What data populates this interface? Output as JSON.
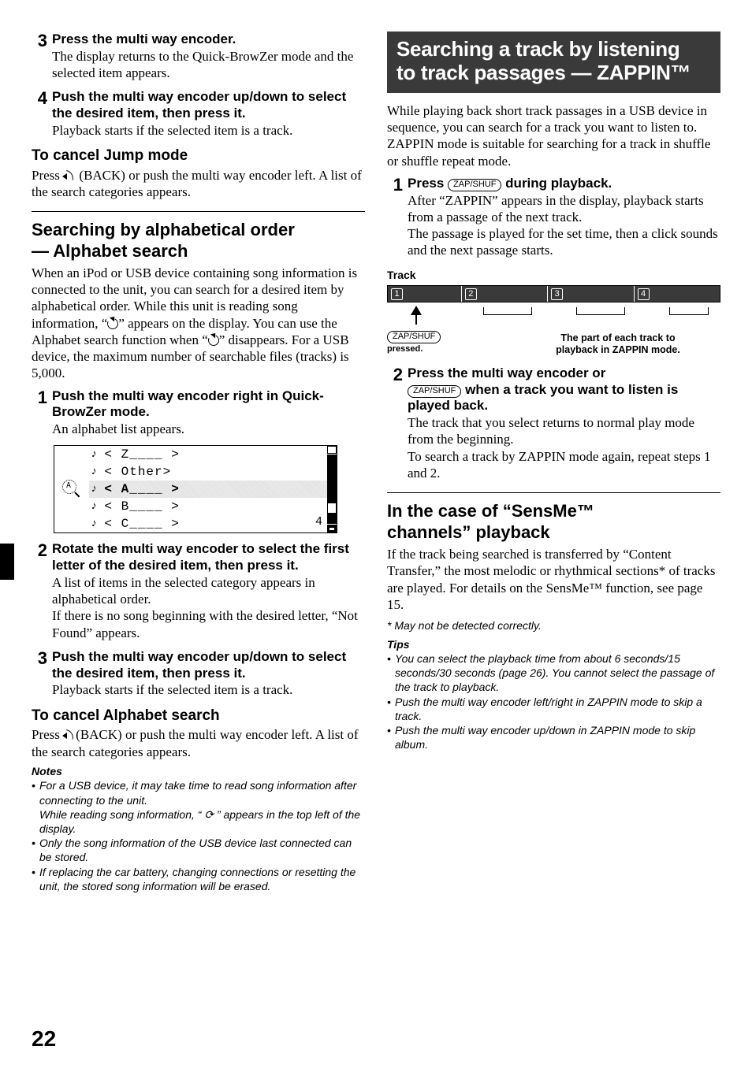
{
  "left": {
    "steps_a": [
      {
        "num": "3",
        "title": "Press the multi way encoder.",
        "text": "The display returns to the Quick-BrowZer mode and the selected item appears."
      },
      {
        "num": "4",
        "title": "Push the multi way encoder up/down to select the desired item, then press it.",
        "text": "Playback starts if the selected item is a track."
      }
    ],
    "cancel_jump": {
      "heading": "To cancel Jump mode",
      "text_before": "Press ",
      "text_after": " (BACK) or push the multi way encoder left. A list of the search categories appears."
    },
    "alpha": {
      "heading_line1": "Searching by alphabetical order",
      "heading_line2": "— Alphabet search",
      "intro_a": "When an iPod or USB device containing song information is connected to the unit, you can search for a desired item by alphabetical order. While this unit is reading song information, “",
      "intro_b": "” appears on the display. You can use the Alphabet search function when “",
      "intro_c": "” disappears. For a USB device, the maximum number of searchable files (tracks) is 5,000.",
      "steps": [
        {
          "num": "1",
          "title": "Push the multi way encoder right in Quick-BrowZer mode.",
          "text": "An alphabet list appears."
        },
        {
          "num": "2",
          "title": "Rotate the multi way encoder to select the first letter of the desired item, then press it.",
          "text": "A list of items in the selected category appears in alphabetical order.\nIf there is no song beginning with the desired letter, “Not Found” appears."
        },
        {
          "num": "3",
          "title": "Push the multi way encoder up/down to select the desired item, then press it.",
          "text": "Playback starts if the selected item is a track."
        }
      ],
      "cancel": {
        "heading": "To cancel Alphabet search",
        "text_before": "Press ",
        "text_after": "(BACK) or push the multi way encoder left. A list of the search categories appears."
      },
      "notes_h": "Notes",
      "notes": [
        "For a USB device, it may take time to read song information after connecting to the unit.\nWhile reading song information, “ ⟳ ” appears in the top left of the display.",
        "Only the song information of the USB device last connected can be stored.",
        "If replacing the car battery, changing connections or resetting the unit, the stored song information will be erased."
      ]
    },
    "lcd": {
      "rows": [
        "< Z____ >",
        "< Other>",
        "< A____ >",
        "< B____ >",
        "< C____ >"
      ],
      "selected_index": 2,
      "counter": "4"
    }
  },
  "right": {
    "banner_line1": "Searching a track by listening",
    "banner_line2": "to track passages — ZAPPIN™",
    "intro": "While playing back short track passages in a USB device in sequence, you can search for a track you want to listen to.\nZAPPIN mode is suitable for searching for a track in shuffle or shuffle repeat mode.",
    "step1": {
      "num": "1",
      "title_a": "Press ",
      "btn": "ZAP/SHUF",
      "title_b": " during playback.",
      "text": "After “ZAPPIN” appears in the display, playback starts from a passage of the next track.\nThe passage is played for the set time, then a click sounds and the next passage starts."
    },
    "track_label": "Track",
    "diagram": {
      "segments": [
        "1",
        "2",
        "3",
        "4"
      ],
      "btn": "ZAP/SHUF",
      "pressed": "pressed.",
      "caption_line1": "The part of each track to",
      "caption_line2": "playback in ZAPPIN mode."
    },
    "step2": {
      "num": "2",
      "title_a": "Press the multi way encoder or ",
      "btn": "ZAP/SHUF",
      "title_b": " when a track you want to listen is played back.",
      "text": "The track that you select returns to normal play mode from the beginning.\nTo search a track by ZAPPIN mode again, repeat steps 1 and 2."
    },
    "sensme": {
      "heading_line1": "In the case of “SensMe™",
      "heading_line2": "channels” playback",
      "text": "If the track being searched is transferred by “Content Transfer,” the most melodic or rhythmical sections* of tracks are played. For details on the SensMe™ function, see page 15.",
      "footnote": "* May not be detected correctly.",
      "tips_h": "Tips",
      "tips": [
        "You can select the playback time from about 6 seconds/15 seconds/30 seconds (page 26). You cannot select the passage of the track to playback.",
        "Push the multi way encoder left/right in ZAPPIN mode to skip a track.",
        "Push the multi way encoder up/down in ZAPPIN mode to skip album."
      ]
    }
  },
  "page_number": "22"
}
